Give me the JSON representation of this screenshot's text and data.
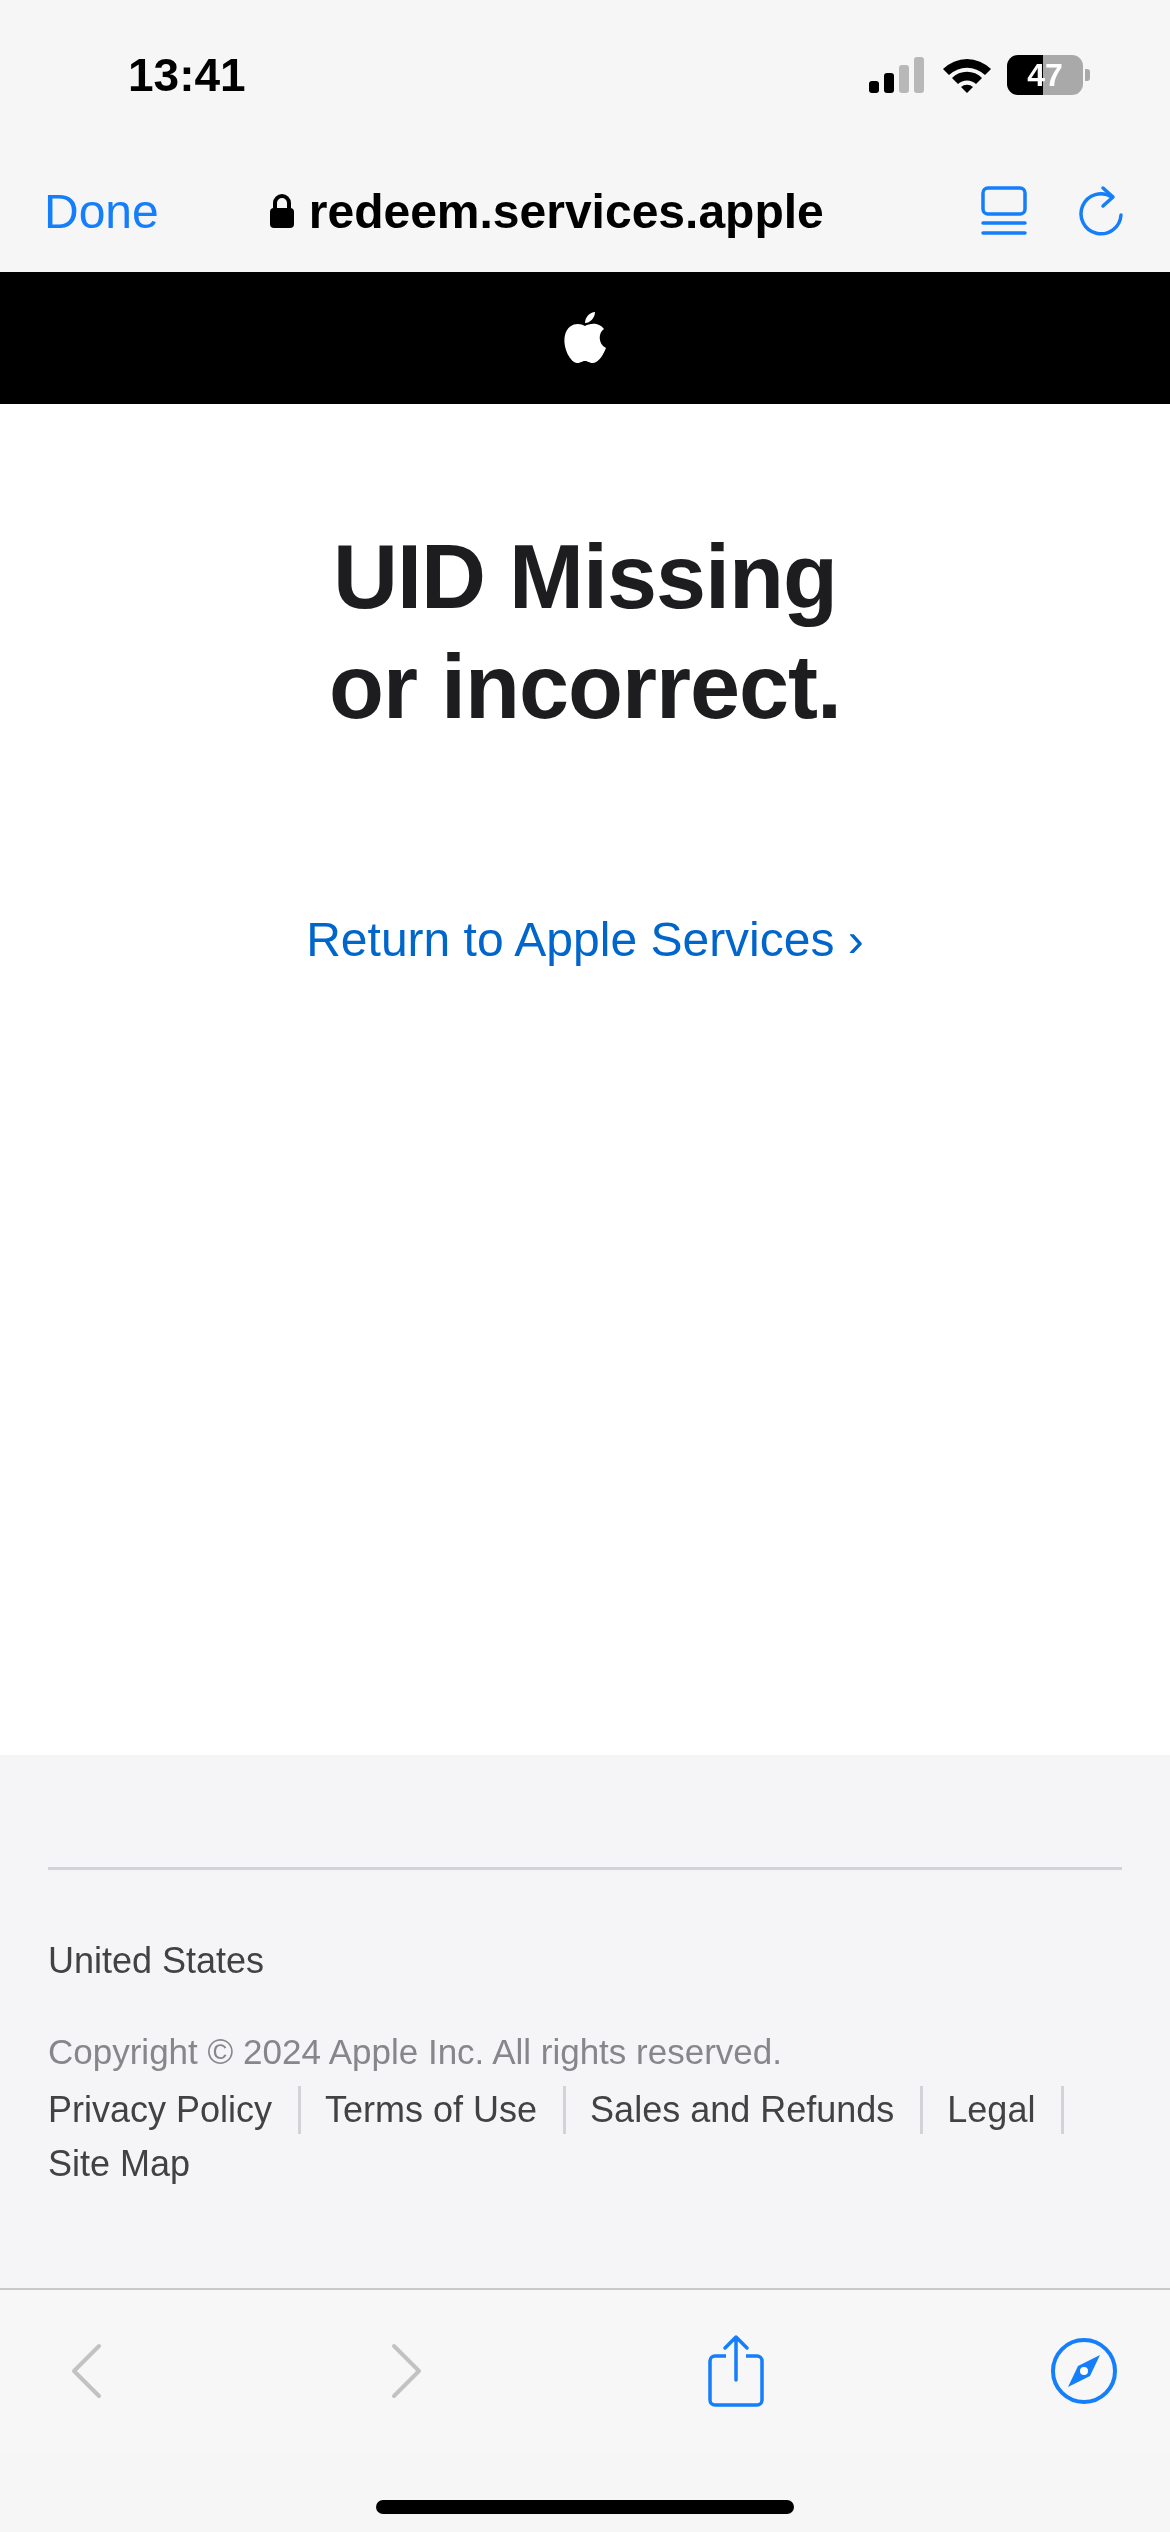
{
  "status_bar": {
    "time": "13:41",
    "battery": "47"
  },
  "nav_bar": {
    "done": "Done",
    "address": "redeem.services.apple"
  },
  "main": {
    "headline": [
      "UID Missing",
      "or incorrect."
    ],
    "link": "Return to Apple Services ›"
  },
  "footer": {
    "country": "United States",
    "copyright": "Copyright © 2024 Apple Inc. All rights reserved.",
    "links": [
      "Privacy Policy",
      "Terms of Use",
      "Sales and Refunds",
      "Legal",
      "Site Map"
    ]
  },
  "toolbar": {
    "back": {
      "disabled": true
    },
    "forward": {
      "disabled": true
    }
  }
}
